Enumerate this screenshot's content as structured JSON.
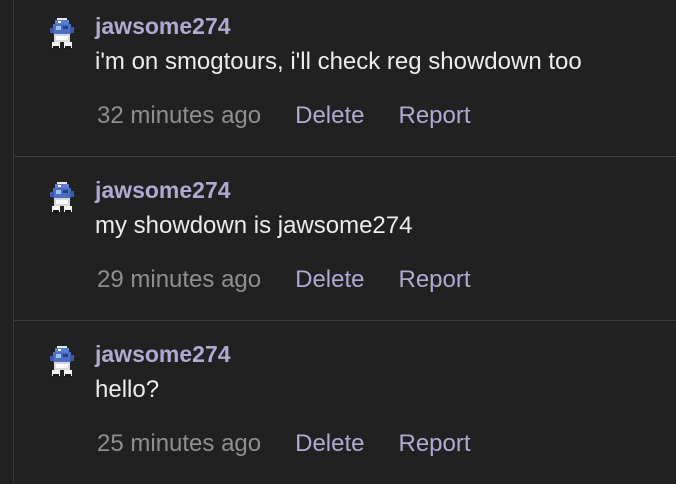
{
  "comments": [
    {
      "username": "jawsome274",
      "text": "i'm on smogtours, i'll check reg showdown too",
      "timestamp": "32 minutes ago",
      "delete_label": "Delete",
      "report_label": "Report"
    },
    {
      "username": "jawsome274",
      "text": "my showdown is jawsome274",
      "timestamp": "29 minutes ago",
      "delete_label": "Delete",
      "report_label": "Report"
    },
    {
      "username": "jawsome274",
      "text": "hello?",
      "timestamp": "25 minutes ago",
      "delete_label": "Delete",
      "report_label": "Report"
    }
  ],
  "colors": {
    "background": "#212121",
    "username": "#b0a9d1",
    "text": "#ececec",
    "timestamp": "#8f8f8f",
    "action": "#b0a9d1"
  },
  "icons": {
    "avatar": "pokemon-sprite-avatar-icon"
  }
}
